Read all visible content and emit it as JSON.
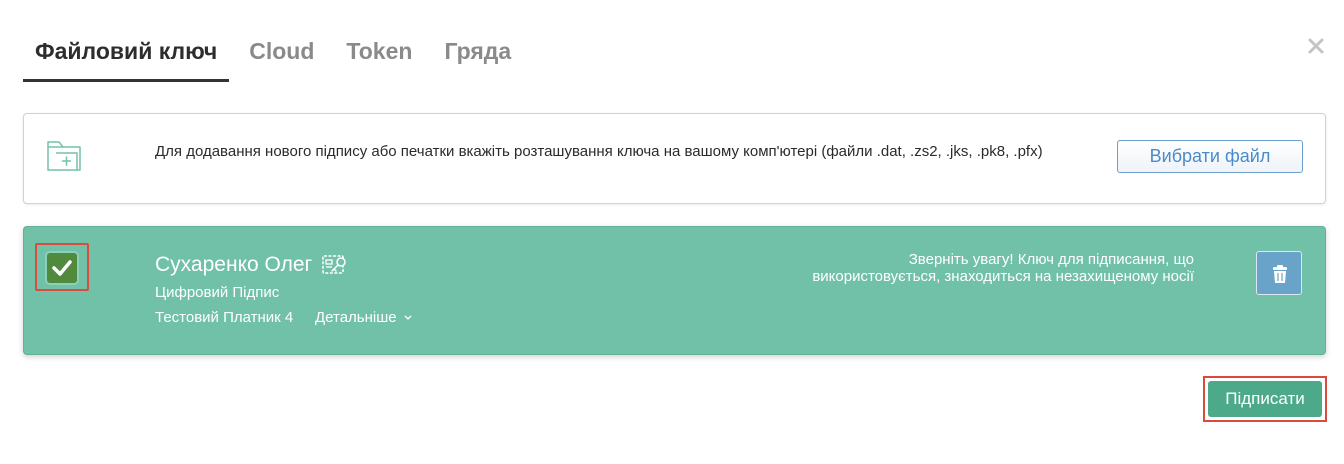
{
  "tabs": [
    {
      "label": "Файловий ключ",
      "active": true
    },
    {
      "label": "Cloud",
      "active": false
    },
    {
      "label": "Token",
      "active": false
    },
    {
      "label": "Гряда",
      "active": false
    }
  ],
  "close_icon": "close-icon",
  "file_panel": {
    "icon": "folder-add-icon",
    "description": "Для додавання нового підпису або печатки вкажіть розташування ключа на вашому комп'ютері (файли .dat, .zs2, .jks, .pk8, .pfx)",
    "choose_button": "Вибрати файл"
  },
  "key": {
    "checked": true,
    "owner": "Сухаренко Олег",
    "signature_type": "Цифровий Підпис",
    "organization": "Тестовий Платник 4",
    "details_label": "Детальніше",
    "warning": "Зверніть увагу! Ключ для підписання, що використовується, знаходиться на незахищеному носії",
    "icons": [
      "certificate-key-icon",
      "trash-icon",
      "checkmark-icon",
      "chevron-down-icon"
    ]
  },
  "sign_button": "Підписати",
  "colors": {
    "card_bg": "#71c0a8",
    "sign_button": "#4caa8a",
    "checkbox": "#4f8a3d",
    "delete_button": "#6aa3c9",
    "highlight": "#d94b3d",
    "link_blue": "#4a8bc9"
  }
}
